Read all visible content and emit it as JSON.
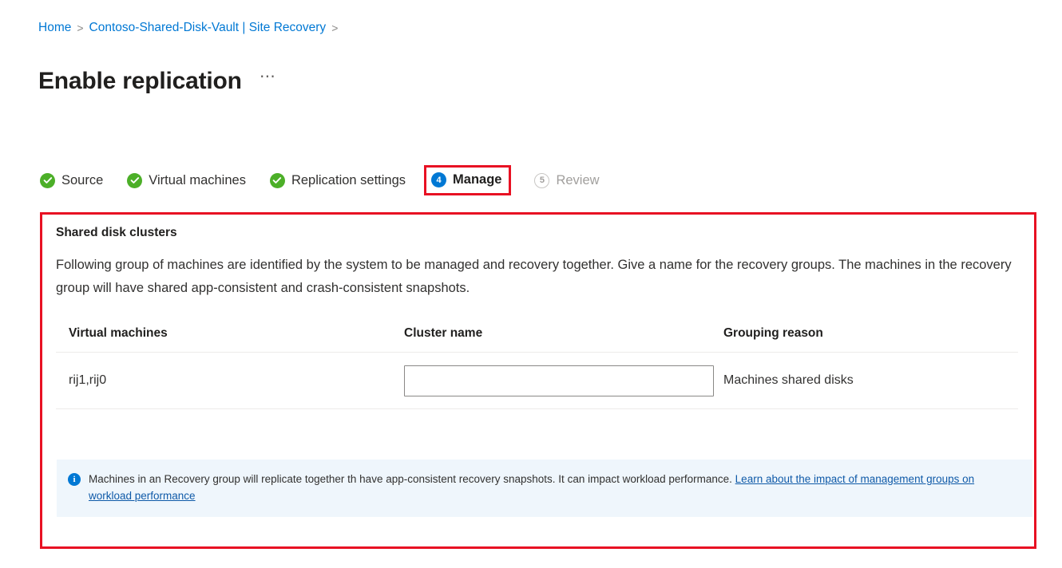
{
  "breadcrumb": {
    "items": [
      {
        "label": "Home",
        "separator": ">"
      },
      {
        "label": "Contoso-Shared-Disk-Vault | Site Recovery",
        "separator": ">"
      }
    ],
    "sep1": ">",
    "sep2": ">",
    "item1": "Home",
    "item2": "Contoso-Shared-Disk-Vault | Site Recovery"
  },
  "header": {
    "title": "Enable replication",
    "more_label": "⋯"
  },
  "wizard": {
    "steps": [
      {
        "label": "Source",
        "state": "done",
        "badge": "✓"
      },
      {
        "label": "Virtual machines",
        "state": "done",
        "badge": "✓"
      },
      {
        "label": "Replication settings",
        "state": "done",
        "badge": "✓"
      },
      {
        "label": "Manage",
        "state": "current",
        "badge": "4"
      },
      {
        "label": "Review",
        "state": "pending",
        "badge": "5"
      }
    ],
    "step0_label": "Source",
    "step1_label": "Virtual machines",
    "step2_label": "Replication settings",
    "step3_label": "Manage",
    "step3_badge": "4",
    "step4_label": "Review",
    "step4_badge": "5"
  },
  "panel": {
    "section_title": "Shared disk clusters",
    "description": "Following group of machines are identified by the system to be managed and recovery together. Give a name for the recovery groups. The machines in the recovery group will have shared app-consistent and crash-consistent snapshots.",
    "table": {
      "headers": {
        "virtual_machines": "Virtual machines",
        "cluster_name": "Cluster name",
        "grouping_reason": "Grouping reason"
      },
      "rows": [
        {
          "virtual_machines": "rij1,rij0",
          "cluster_name_value": "",
          "cluster_name_placeholder": "",
          "grouping_reason": "Machines shared disks"
        }
      ],
      "row0_vms": "rij1,rij0",
      "row0_value": "",
      "row0_placeholder": "",
      "row0_reason": "Machines shared disks"
    },
    "info": {
      "icon": "i",
      "text_before_link": "Machines in an Recovery group will replicate together th have app-consistent recovery snapshots. It can impact workload performance. ",
      "link_text": "Learn about the impact of management groups on workload performance"
    }
  },
  "colors": {
    "accent_blue": "#0078d4",
    "link_blue": "#0078d4",
    "success_green": "#4caf28",
    "highlight_red": "#e81123",
    "info_bg": "#eff6fc",
    "pending_gray": "#a19f9d"
  }
}
